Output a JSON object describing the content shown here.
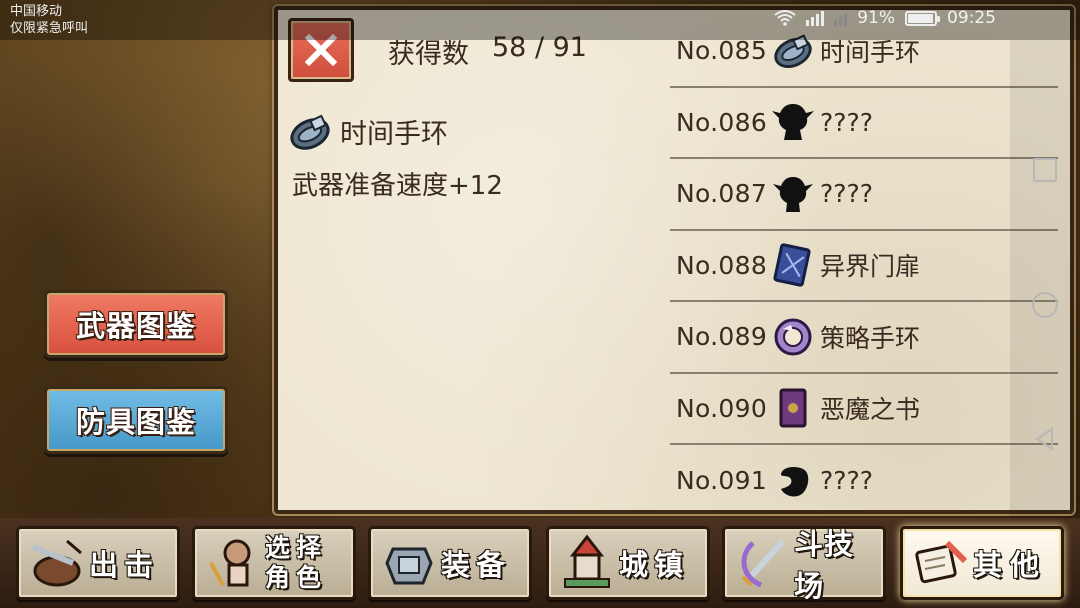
{
  "status_bar": {
    "carrier": "中国移动",
    "emergency": "仅限紧急呼叫",
    "battery": "91%",
    "time": "09:25"
  },
  "side_buttons": {
    "weapon_label": "武器图鉴",
    "armor_label": "防具图鉴"
  },
  "panel": {
    "count_label": "获得数",
    "count_value": "58 / 91",
    "selected_item": {
      "name": "时间手环",
      "icon": "bracelet-icon",
      "effect": "武器准备速度+12"
    }
  },
  "items": [
    {
      "no": "No.085",
      "name": "时间手环",
      "icon": "bracelet-icon"
    },
    {
      "no": "No.086",
      "name": "????",
      "icon": "unknown-silhouette-icon"
    },
    {
      "no": "No.087",
      "name": "????",
      "icon": "unknown-silhouette-icon"
    },
    {
      "no": "No.088",
      "name": "异界门扉",
      "icon": "portal-card-icon"
    },
    {
      "no": "No.089",
      "name": "策略手环",
      "icon": "purple-bracelet-icon"
    },
    {
      "no": "No.090",
      "name": "恶魔之书",
      "icon": "demon-book-icon"
    },
    {
      "no": "No.091",
      "name": "????",
      "icon": "unknown-blob-icon"
    }
  ],
  "tabs": [
    {
      "label": "出击",
      "icon": "sortie-icon"
    },
    {
      "label": "选择角色",
      "icon": "character-icon"
    },
    {
      "label": "装备",
      "icon": "equipment-icon"
    },
    {
      "label": "城镇",
      "icon": "town-icon"
    },
    {
      "label": "斗技场",
      "icon": "arena-icon"
    },
    {
      "label": "其他",
      "icon": "other-icon"
    }
  ],
  "colors": {
    "weapon_button": "#e0604a",
    "armor_button": "#5aaad8",
    "close_button": "#d9503f",
    "parchment": "#efe7d2"
  }
}
